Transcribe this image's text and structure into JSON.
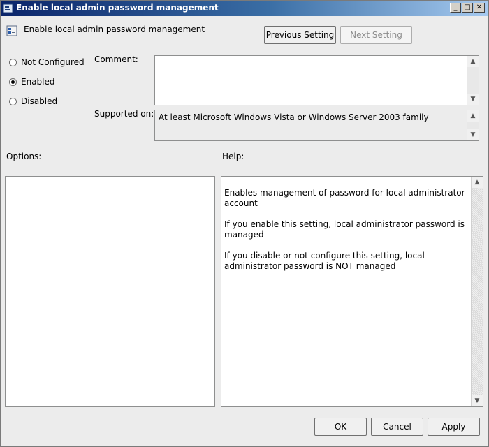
{
  "window": {
    "title": "Enable local admin password management",
    "buttons": {
      "minimize": "_",
      "maximize": "□",
      "close": "✕"
    }
  },
  "header": {
    "policy_name": "Enable local admin password management",
    "previous_label": "Previous Setting",
    "next_label": "Next Setting"
  },
  "state": {
    "options": [
      {
        "label": "Not Configured",
        "checked": false
      },
      {
        "label": "Enabled",
        "checked": true
      },
      {
        "label": "Disabled",
        "checked": false
      }
    ]
  },
  "comment": {
    "label": "Comment:",
    "value": ""
  },
  "supported": {
    "label": "Supported on:",
    "value": "At least Microsoft Windows Vista or Windows Server 2003 family"
  },
  "options_section": {
    "label": "Options:"
  },
  "help_section": {
    "label": "Help:",
    "paragraphs": [
      "Enables management of password for local administrator account",
      "If you enable this setting, local administrator password is managed",
      "If you disable or not configure this setting, local administrator password is NOT managed"
    ]
  },
  "footer": {
    "ok_label": "OK",
    "cancel_label": "Cancel",
    "apply_label": "Apply"
  },
  "icons": {
    "scroll_up": "▲",
    "scroll_down": "▼"
  }
}
